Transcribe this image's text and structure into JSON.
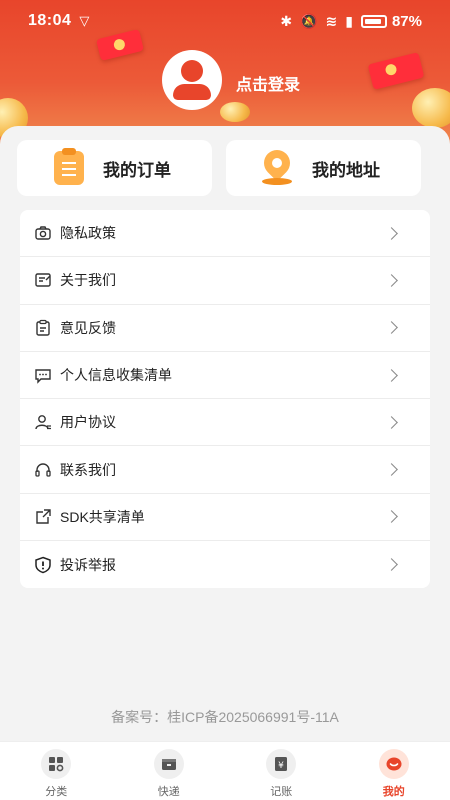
{
  "status_bar": {
    "time": "18:04",
    "battery": "87%"
  },
  "profile": {
    "login_label": "点击登录"
  },
  "cards": {
    "orders": "我的订单",
    "address": "我的地址"
  },
  "menu": [
    {
      "label": "隐私政策",
      "icon": "camera-icon"
    },
    {
      "label": "关于我们",
      "icon": "edit-note-icon"
    },
    {
      "label": "意见反馈",
      "icon": "clipboard-icon"
    },
    {
      "label": "个人信息收集清单",
      "icon": "chat-icon"
    },
    {
      "label": "用户协议",
      "icon": "user-icon"
    },
    {
      "label": "联系我们",
      "icon": "headset-icon"
    },
    {
      "label": "SDK共享清单",
      "icon": "share-icon"
    },
    {
      "label": "投诉举报",
      "icon": "alert-shield-icon"
    }
  ],
  "footer": {
    "icp": "备案号：桂ICP备2025066991号-11A"
  },
  "tabs": [
    {
      "label": "分类",
      "icon": "grid-search-icon"
    },
    {
      "label": "快递",
      "icon": "package-icon"
    },
    {
      "label": "记账",
      "icon": "yen-book-icon"
    },
    {
      "label": "我的",
      "icon": "profile-icon",
      "active": true
    }
  ],
  "colors": {
    "accent": "#e8452b",
    "card_icon": "#ffb24d"
  }
}
